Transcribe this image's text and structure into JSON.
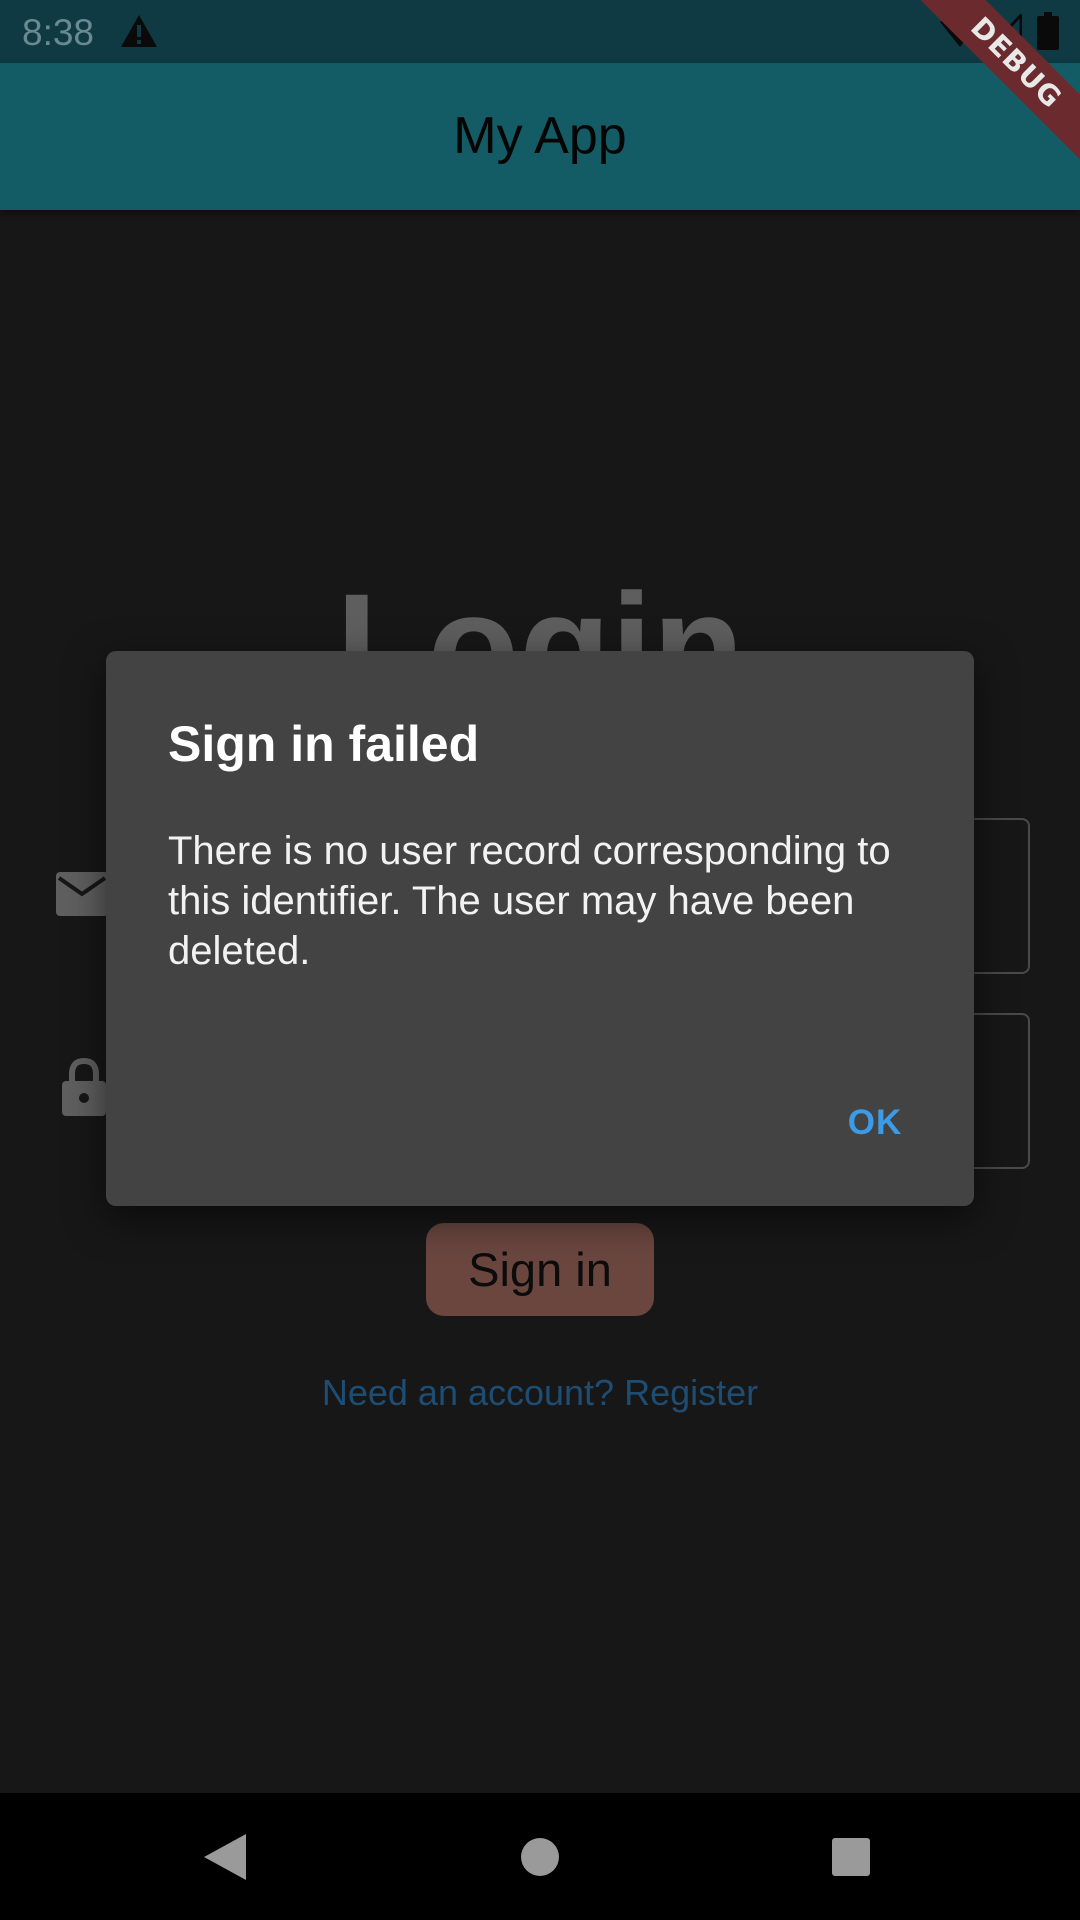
{
  "status_bar": {
    "time": "8:38",
    "icons": [
      "warning-icon",
      "wifi-icon",
      "cell-signal-icon",
      "battery-icon"
    ]
  },
  "debug_banner": "DEBUG",
  "app_bar": {
    "title": "My App"
  },
  "login": {
    "heading": "Login",
    "email_icon": "email-icon",
    "password_icon": "lock-icon",
    "sign_in_label": "Sign in",
    "register_link": "Need an account? Register"
  },
  "dialog": {
    "title": "Sign in failed",
    "message": "There is no user record corresponding to this identifier. The user may have been deleted.",
    "ok_label": "OK"
  },
  "nav_bar": {
    "buttons": [
      "back-icon",
      "home-icon",
      "recents-icon"
    ]
  },
  "colors": {
    "status_bar": "#0f3a44",
    "app_bar": "#135b65",
    "background": "#181718",
    "dialog": "#434343",
    "accent": "#3b9be6",
    "sign_in_button": "#6a463f",
    "debug_banner": "#6b2a2e"
  }
}
